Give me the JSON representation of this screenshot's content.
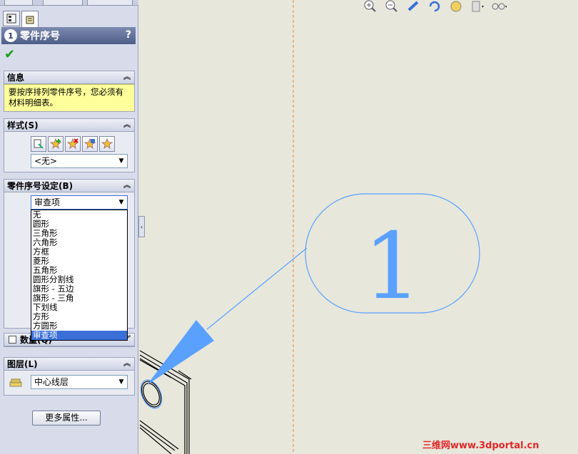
{
  "panel": {
    "title": "零件序号",
    "help": "?",
    "ok_icon": "checkmark-icon",
    "info": {
      "header": "信息",
      "text_line1": "要按序排列零件序号，您必须有",
      "text_line2": "材料明细表。"
    },
    "style": {
      "header": "样式(S)",
      "selected": "<无>"
    },
    "balloon_settings": {
      "header": "零件序号设定(B)",
      "selected": "审查项",
      "options": [
        "无",
        "圆形",
        "三角形",
        "六角形",
        "方框",
        "菱形",
        "五角形",
        "圆形分割线",
        "旗形 - 五边",
        "旗形 - 三角",
        "下划线",
        "方形",
        "方圆形",
        "审查项"
      ],
      "highlighted_index": 13
    },
    "quantity": {
      "header": "数量(Q)"
    },
    "layer": {
      "header": "图层(L)",
      "selected": "中心线层"
    },
    "more_button": "更多属性..."
  },
  "drawing": {
    "balloon_number": "1",
    "balloon_color": "#5aa0ff"
  },
  "watermark": "三维网www.3dportal.cn",
  "colors": {
    "canvas_bg": "#e8e7dc",
    "panel_bg": "#d8dcea",
    "title_bar": "#4e5d87",
    "info_bg": "#fefe9a",
    "selection": "#3a6fd8",
    "watermark": "#e12828"
  }
}
